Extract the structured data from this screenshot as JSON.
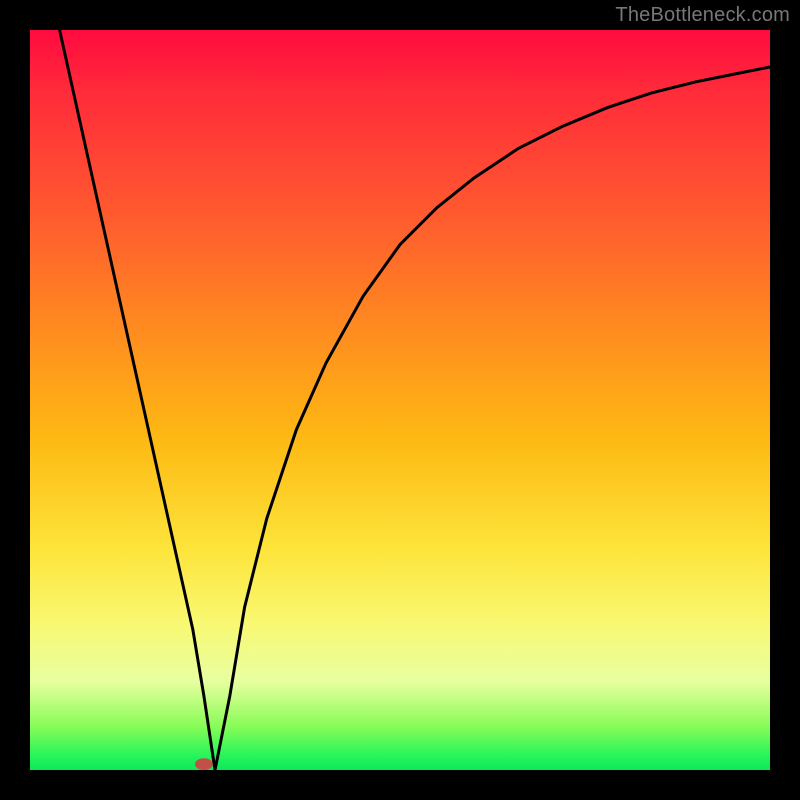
{
  "watermark": "TheBottleneck.com",
  "chart_data": {
    "type": "line",
    "title": "",
    "xlabel": "",
    "ylabel": "",
    "xlim": [
      0,
      100
    ],
    "ylim": [
      0,
      100
    ],
    "grid": false,
    "legend": false,
    "series": [
      {
        "name": "curve",
        "x": [
          4,
          6,
          8,
          10,
          12,
          14,
          16,
          18,
          20,
          22,
          23.5,
          25,
          27,
          29,
          32,
          36,
          40,
          45,
          50,
          55,
          60,
          66,
          72,
          78,
          84,
          90,
          96,
          100
        ],
        "y": [
          100,
          91,
          82,
          73,
          64,
          55,
          46,
          37,
          28,
          19,
          10,
          0,
          10,
          22,
          34,
          46,
          55,
          64,
          71,
          76,
          80,
          84,
          87,
          89.5,
          91.5,
          93,
          94.2,
          95
        ]
      }
    ],
    "marker": {
      "x": 23.5,
      "y": 0.8,
      "rx": 1.2,
      "ry": 0.8,
      "color": "#c05048"
    },
    "background_gradient_stops": [
      {
        "pos": 0.0,
        "color": "#ff0b3f"
      },
      {
        "pos": 0.25,
        "color": "#ff5a2f"
      },
      {
        "pos": 0.55,
        "color": "#fdb813"
      },
      {
        "pos": 0.8,
        "color": "#f9f871"
      },
      {
        "pos": 0.94,
        "color": "#8afc58"
      },
      {
        "pos": 1.0,
        "color": "#0ce85b"
      }
    ]
  }
}
